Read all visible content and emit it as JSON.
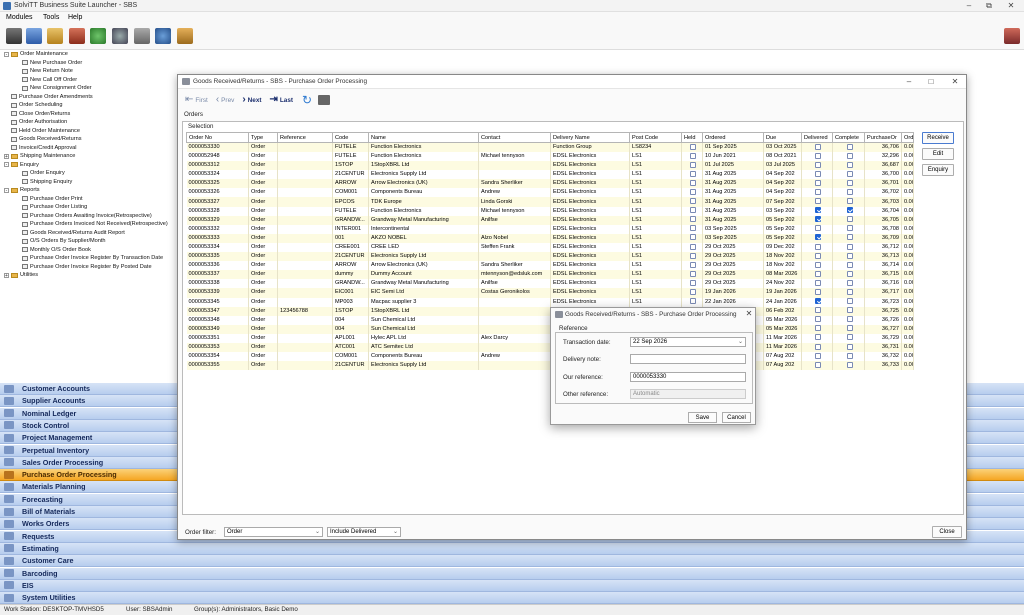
{
  "app": {
    "title": "SolviTT Business Suite Launcher - SBS"
  },
  "menu": [
    "Modules",
    "Tools",
    "Help"
  ],
  "tree": [
    {
      "label": "Order Maintenance",
      "level": 0,
      "kind": "folder-open"
    },
    {
      "label": "New Purchase Order",
      "level": 1,
      "kind": "item"
    },
    {
      "label": "New Return Note",
      "level": 1,
      "kind": "item"
    },
    {
      "label": "New Call Off Order",
      "level": 1,
      "kind": "item"
    },
    {
      "label": "New Consignment Order",
      "level": 1,
      "kind": "item"
    },
    {
      "label": "Purchase Order Amendments",
      "level": 0,
      "kind": "item"
    },
    {
      "label": "Order Scheduling",
      "level": 0,
      "kind": "item"
    },
    {
      "label": "Close Order/Returns",
      "level": 0,
      "kind": "item"
    },
    {
      "label": "Order Authorisation",
      "level": 0,
      "kind": "item"
    },
    {
      "label": "Held Order Maintenance",
      "level": 0,
      "kind": "item"
    },
    {
      "label": "Goods Received/Returns",
      "level": 0,
      "kind": "item"
    },
    {
      "label": "Invoice/Credit Approval",
      "level": 0,
      "kind": "item"
    },
    {
      "label": "Shipping Maintenance",
      "level": 0,
      "kind": "folder"
    },
    {
      "label": "Enquiry",
      "level": 0,
      "kind": "folder-open"
    },
    {
      "label": "Order Enquiry",
      "level": 1,
      "kind": "item"
    },
    {
      "label": "Shipping Enquiry",
      "level": 1,
      "kind": "item"
    },
    {
      "label": "Reports",
      "level": 0,
      "kind": "folder-open"
    },
    {
      "label": "Purchase Order Print",
      "level": 1,
      "kind": "item"
    },
    {
      "label": "Purchase Order Listing",
      "level": 1,
      "kind": "item"
    },
    {
      "label": "Purchase Orders Awaiting Invoice(Retrospective)",
      "level": 1,
      "kind": "item"
    },
    {
      "label": "Purchase Orders Invoiced Not Received(Retrospective)",
      "level": 1,
      "kind": "item"
    },
    {
      "label": "Goods Received/Returns Audit Report",
      "level": 1,
      "kind": "item"
    },
    {
      "label": "O/S Orders By Supplier/Month",
      "level": 1,
      "kind": "item"
    },
    {
      "label": "Monthly O/S Order Book",
      "level": 1,
      "kind": "item"
    },
    {
      "label": "Purchase Order Invoice Register By Transaction Date",
      "level": 1,
      "kind": "item"
    },
    {
      "label": "Purchase Order Invoice Register By Posted Date",
      "level": 1,
      "kind": "item"
    },
    {
      "label": "Utilities",
      "level": 0,
      "kind": "folder"
    }
  ],
  "modules": [
    {
      "label": "Customer Accounts",
      "selected": false
    },
    {
      "label": "Supplier Accounts",
      "selected": false
    },
    {
      "label": "Nominal Ledger",
      "selected": false
    },
    {
      "label": "Stock Control",
      "selected": false
    },
    {
      "label": "Project Management",
      "selected": false
    },
    {
      "label": "Perpetual Inventory",
      "selected": false
    },
    {
      "label": "Sales Order Processing",
      "selected": false
    },
    {
      "label": "Purchase Order Processing",
      "selected": true
    },
    {
      "label": "Materials Planning",
      "selected": false
    },
    {
      "label": "Forecasting",
      "selected": false
    },
    {
      "label": "Bill of Materials",
      "selected": false
    },
    {
      "label": "Works Orders",
      "selected": false
    },
    {
      "label": "Requests",
      "selected": false
    },
    {
      "label": "Estimating",
      "selected": false
    },
    {
      "label": "Customer Care",
      "selected": false
    },
    {
      "label": "Barcoding",
      "selected": false
    },
    {
      "label": "EIS",
      "selected": false
    },
    {
      "label": "System Utilities",
      "selected": false
    }
  ],
  "status": {
    "workstation": "Work Station: DESKTOP-TMVHSD5",
    "user": "User: SBSAdmin",
    "groups": "Group(s): Administrators, Basic Demo"
  },
  "window": {
    "title": "Goods Received/Returns - SBS - Purchase Order Processing",
    "nav": {
      "first": "First",
      "prev": "Prev",
      "next": "Next",
      "last": "Last"
    },
    "tab": "Orders",
    "selection_label": "Selection",
    "columns": [
      "Order No",
      "Type",
      "Reference",
      "Code",
      "Name",
      "Contact",
      "Delivery Name",
      "Post Code",
      "Held",
      "Ordered",
      "Due",
      "Delivered",
      "Complete",
      "PurchaseOr",
      "Order"
    ],
    "rows": [
      [
        "0000053330",
        "Order",
        "",
        "FUTELE",
        "Function Electronics",
        "",
        "Function Group",
        "LS8234",
        false,
        "01 Sep 2025",
        "03 Oct 2025",
        false,
        false,
        "36,706",
        "0.000"
      ],
      [
        "0000052948",
        "Order",
        "",
        "FUTELE",
        "Function Electronics",
        "Michael tennyson",
        "EDSL Electronics",
        "LS1",
        false,
        "10 Jun 2021",
        "08 Oct 2021",
        false,
        false,
        "32,296",
        "0.000"
      ],
      [
        "0000053312",
        "Order",
        "",
        "1STOP",
        "1StopXBRL Ltd",
        "",
        "EDSL Electronics",
        "LS1",
        false,
        "01 Jul 2025",
        "03 Jul 2025",
        false,
        false,
        "36,687",
        "0.000"
      ],
      [
        "0000053324",
        "Order",
        "",
        "21CENTUR",
        "Electronics Supply Ltd",
        "",
        "EDSL Electronics",
        "LS1",
        false,
        "31 Aug 2025",
        "04 Sep 202",
        false,
        false,
        "36,700",
        "0.000"
      ],
      [
        "0000053325",
        "Order",
        "",
        "ARROW",
        "Arrow Electronics (UK)",
        "Sandra Sherliker",
        "EDSL Electronics",
        "LS1",
        false,
        "31 Aug 2025",
        "04 Sep 202",
        false,
        false,
        "36,701",
        "0.000"
      ],
      [
        "0000053326",
        "Order",
        "",
        "COM001",
        "Components Bureau",
        "Andrew",
        "EDSL Electronics",
        "LS1",
        false,
        "31 Aug 2025",
        "04 Sep 202",
        false,
        false,
        "36,702",
        "0.000"
      ],
      [
        "0000053327",
        "Order",
        "",
        "EPCOS",
        "TDK Europe",
        "Linda Gorski",
        "EDSL Electronics",
        "LS1",
        false,
        "31 Aug 2025",
        "07 Sep 202",
        false,
        false,
        "36,703",
        "0.000"
      ],
      [
        "0000053328",
        "Order",
        "",
        "FUTELE",
        "Function Electronics",
        "Michael tennyson",
        "EDSL Electronics",
        "LS1",
        false,
        "31 Aug 2025",
        "03 Sep 202",
        true,
        true,
        "36,704",
        "0.000"
      ],
      [
        "0000053329",
        "Order",
        "",
        "GRANDW...",
        "Grandway Metal Manufacturing",
        "Anilfse",
        "EDSL Electronics",
        "LS1",
        false,
        "31 Aug 2025",
        "05 Sep 202",
        true,
        false,
        "36,705",
        "0.000"
      ],
      [
        "0000053332",
        "Order",
        "",
        "INTER001",
        "Intercontinental",
        "",
        "EDSL Electronics",
        "LS1",
        false,
        "03 Sep 2025",
        "05 Sep 202",
        false,
        false,
        "36,708",
        "0.000"
      ],
      [
        "0000053333",
        "Order",
        "",
        "001",
        "AKZO NOBEL",
        "Alzo Nobel",
        "EDSL Electronics",
        "LS1",
        false,
        "03 Sep 2025",
        "05 Sep 202",
        true,
        false,
        "36,709",
        "0.000"
      ],
      [
        "0000053334",
        "Order",
        "",
        "CREE001",
        "CREE LED",
        "Steffen Frank",
        "EDSL Electronics",
        "LS1",
        false,
        "29 Oct 2025",
        "09 Dec 202",
        false,
        false,
        "36,712",
        "0.000"
      ],
      [
        "0000053335",
        "Order",
        "",
        "21CENTUR",
        "Electronics Supply Ltd",
        "",
        "EDSL Electronics",
        "LS1",
        false,
        "29 Oct 2025",
        "18 Nov 202",
        false,
        false,
        "36,713",
        "0.000"
      ],
      [
        "0000053336",
        "Order",
        "",
        "ARROW",
        "Arrow Electronics (UK)",
        "Sandra Sherliker",
        "EDSL Electronics",
        "LS1",
        false,
        "29 Oct 2025",
        "18 Nov 202",
        false,
        false,
        "36,714",
        "0.000"
      ],
      [
        "0000053337",
        "Order",
        "",
        "dummy",
        "Dummy Account",
        "mtennyson@edsluk.com",
        "EDSL Electronics",
        "LS1",
        false,
        "29 Oct 2025",
        "08 Mar 2026",
        false,
        false,
        "36,715",
        "0.000"
      ],
      [
        "0000053338",
        "Order",
        "",
        "GRANDW...",
        "Grandway Metal Manufacturing",
        "Anilfse",
        "EDSL Electronics",
        "LS1",
        false,
        "29 Oct 2025",
        "24 Nov 202",
        false,
        false,
        "36,716",
        "0.000"
      ],
      [
        "0000053339",
        "Order",
        "",
        "EIC001",
        "EIC Semi Ltd",
        "Costas Geronikolos",
        "EDSL Electronics",
        "LS1",
        false,
        "19 Jan 2026",
        "19 Jan 2026",
        false,
        false,
        "36,717",
        "0.000"
      ],
      [
        "0000053345",
        "Order",
        "",
        "MP003",
        "Macpac supplier 3",
        "",
        "EDSL Electronics",
        "LS1",
        false,
        "22 Jan 2026",
        "24 Jan 2026",
        true,
        false,
        "36,723",
        "0.000"
      ],
      [
        "0000053347",
        "Order",
        "123456788",
        "1STOP",
        "1StopXBRL Ltd",
        "",
        "",
        "",
        false,
        "",
        "06 Feb 202",
        false,
        false,
        "36,725",
        "0.000"
      ],
      [
        "0000053348",
        "Order",
        "",
        "004",
        "Sun Chemical Ltd",
        "",
        "",
        "",
        false,
        "",
        "05 Mar 2026",
        false,
        false,
        "36,726",
        "0.000"
      ],
      [
        "0000053349",
        "Order",
        "",
        "004",
        "Sun Chemical Ltd",
        "",
        "",
        "",
        false,
        "",
        "05 Mar 2026",
        false,
        false,
        "36,727",
        "0.000"
      ],
      [
        "0000053351",
        "Order",
        "",
        "APL001",
        "Hylec APL Ltd",
        "Alex Darcy",
        "",
        "",
        false,
        "",
        "11 Mar 2026",
        false,
        false,
        "36,729",
        "0.000"
      ],
      [
        "0000053353",
        "Order",
        "",
        "ATC001",
        "ATC Semitec Ltd",
        "",
        "",
        "",
        false,
        "",
        "11 Mar 2026",
        false,
        false,
        "36,731",
        "0.000"
      ],
      [
        "0000053354",
        "Order",
        "",
        "COM001",
        "Components Bureau",
        "Andrew",
        "",
        "",
        false,
        "",
        "07 Aug 202",
        false,
        false,
        "36,732",
        "0.000"
      ],
      [
        "0000053355",
        "Order",
        "",
        "21CENTUR",
        "Electronics Supply Ltd",
        "",
        "",
        "",
        false,
        "",
        "07 Aug 202",
        false,
        false,
        "36,733",
        "0.000"
      ]
    ],
    "side_buttons": {
      "receive": "Receive",
      "edit": "Edit",
      "enquiry": "Enquiry"
    },
    "footer": {
      "filter_label": "Order filter:",
      "filter_value": "Order",
      "include_value": "Include Delivered",
      "close": "Close"
    }
  },
  "dialog": {
    "title": "Goods Received/Returns - SBS - Purchase Order Processing",
    "group": "Reference",
    "transaction_date_label": "Transaction date:",
    "transaction_date": "22 Sep 2026",
    "delivery_note_label": "Delivery note:",
    "delivery_note": "",
    "our_reference_label": "Our reference:",
    "our_reference": "0000053330",
    "other_reference_label": "Other reference:",
    "other_reference": "Automatic",
    "save": "Save",
    "cancel": "Cancel"
  },
  "colors": {
    "module_bar": "#c6d7f1",
    "module_selected": "#f7b84a",
    "row_alt": "#fdfbe1",
    "check_on": "#1e63d4"
  }
}
